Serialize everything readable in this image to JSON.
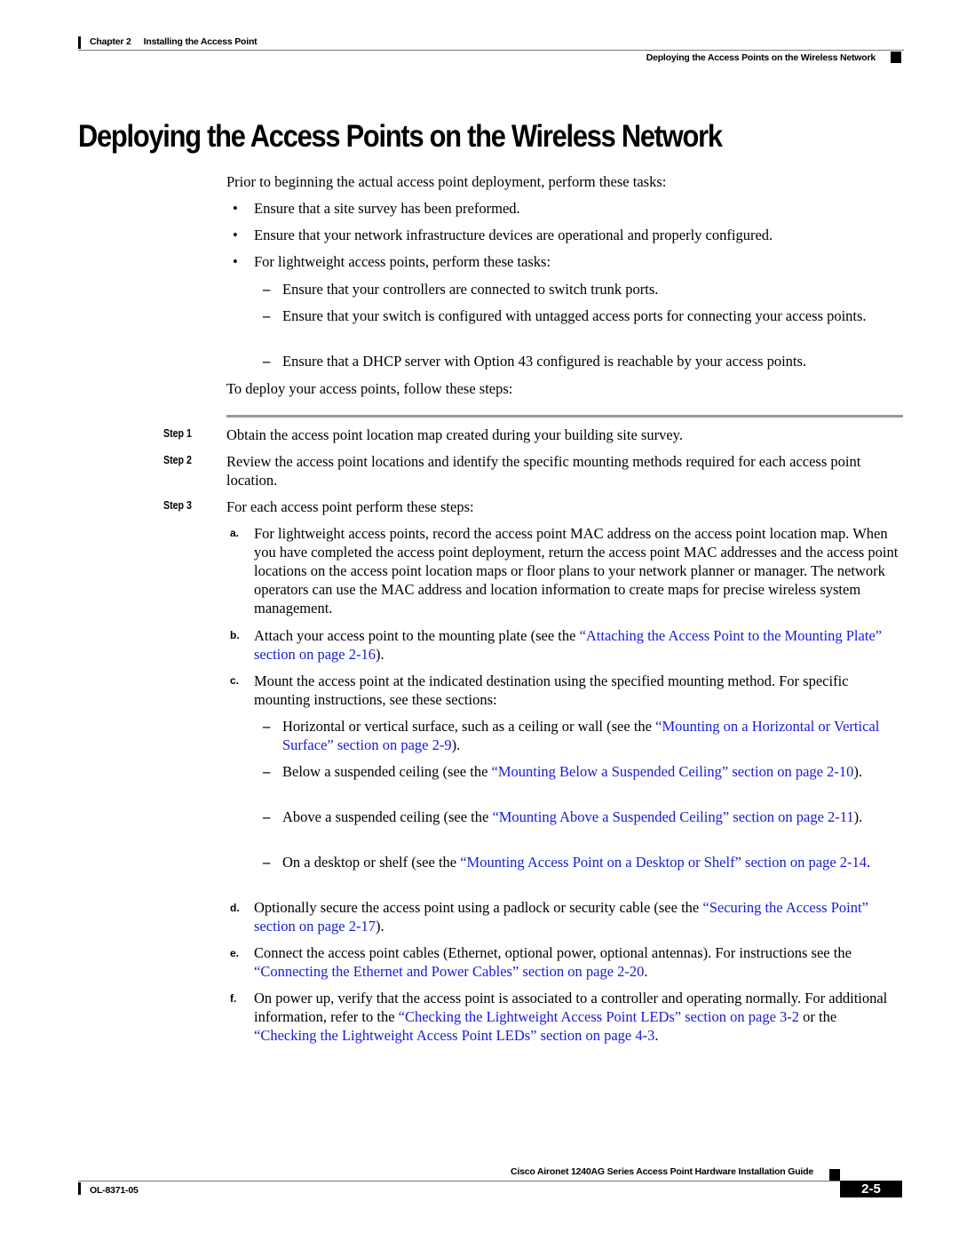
{
  "header": {
    "chapter": "Chapter 2",
    "chapter_title": "Installing the Access Point",
    "section": "Deploying the Access Points on the Wireless Network"
  },
  "title": "Deploying the Access Points on the Wireless Network",
  "intro": "Prior to beginning the actual access point deployment, perform these tasks:",
  "bullets": [
    "Ensure that a site survey has been preformed.",
    "Ensure that your network infrastructure devices are operational and properly configured.",
    "For lightweight access points, perform these tasks:"
  ],
  "bullet_symbol": "•",
  "dash_symbol": "–",
  "sub_bullets": [
    "Ensure that your controllers are connected to switch trunk ports.",
    "Ensure that your switch is configured with untagged access ports for connecting your access points.",
    "Ensure that a DHCP server with Option 43 configured is reachable by your access points."
  ],
  "steps_intro": "To deploy your access points, follow these steps:",
  "steps": [
    {
      "label": "Step 1",
      "text": "Obtain the access point location map created during your building site survey."
    },
    {
      "label": "Step 2",
      "text": "Review the access point locations and identify the specific mounting methods required for each access point location."
    },
    {
      "label": "Step 3",
      "text": "For each access point perform these steps:"
    }
  ],
  "substeps": {
    "a": {
      "label": "a.",
      "text": "For lightweight access points, record the access point MAC address on the access point location map. When you have completed the access point deployment, return the access point MAC addresses and the access point locations on the access point location maps or floor plans to your network planner or manager. The network operators can use the MAC address and location information to create maps for precise wireless system management."
    },
    "b": {
      "label": "b.",
      "pre": "Attach your access point to the mounting plate (see the ",
      "link": "“Attaching the Access Point to the Mounting Plate” section on page 2-16",
      "post": ")."
    },
    "c": {
      "label": "c.",
      "text": "Mount the access point at the indicated destination using the specified mounting method. For specific mounting instructions, see these sections:",
      "items": [
        {
          "pre": "Horizontal or vertical surface, such as a ceiling or wall (see the ",
          "link": "“Mounting on a Horizontal or Vertical Surface” section on page 2-9",
          "post": ")."
        },
        {
          "pre": "Below a suspended ceiling (see the ",
          "link": "“Mounting Below a Suspended Ceiling” section on page 2-10",
          "post": ")."
        },
        {
          "pre": "Above a suspended ceiling (see the ",
          "link": "“Mounting Above a Suspended Ceiling” section on page 2-11",
          "post": ")."
        },
        {
          "pre": "On a desktop or shelf (see the ",
          "link": "“Mounting Access Point on a Desktop or Shelf” section on page 2-14",
          "post": "."
        }
      ]
    },
    "d": {
      "label": "d.",
      "pre": "Optionally secure the access point using a padlock or security cable (see the ",
      "link": "“Securing the Access Point” section on page 2-17",
      "post": ")."
    },
    "e": {
      "label": "e.",
      "pre": "Connect the access point cables (Ethernet, optional power, optional antennas). For instructions see the ",
      "link": "“Connecting the Ethernet and Power Cables” section on page 2-20",
      "post": "."
    },
    "f": {
      "label": "f.",
      "pre": "On power up, verify that the access point is associated to a controller and operating normally. For additional information, refer to the ",
      "link1": "“Checking the Lightweight Access Point LEDs” section on page 3-2",
      "mid": " or the ",
      "link2": "“Checking the Lightweight Access Point LEDs” section on page 4-3",
      "post": "."
    }
  },
  "footer": {
    "guide_title": "Cisco Aironet 1240AG Series Access Point Hardware Installation Guide",
    "doc_number": "OL-8371-05",
    "page_number": "2-5"
  },
  "colors": {
    "link": "#1a1ad6",
    "rule": "#999999"
  }
}
